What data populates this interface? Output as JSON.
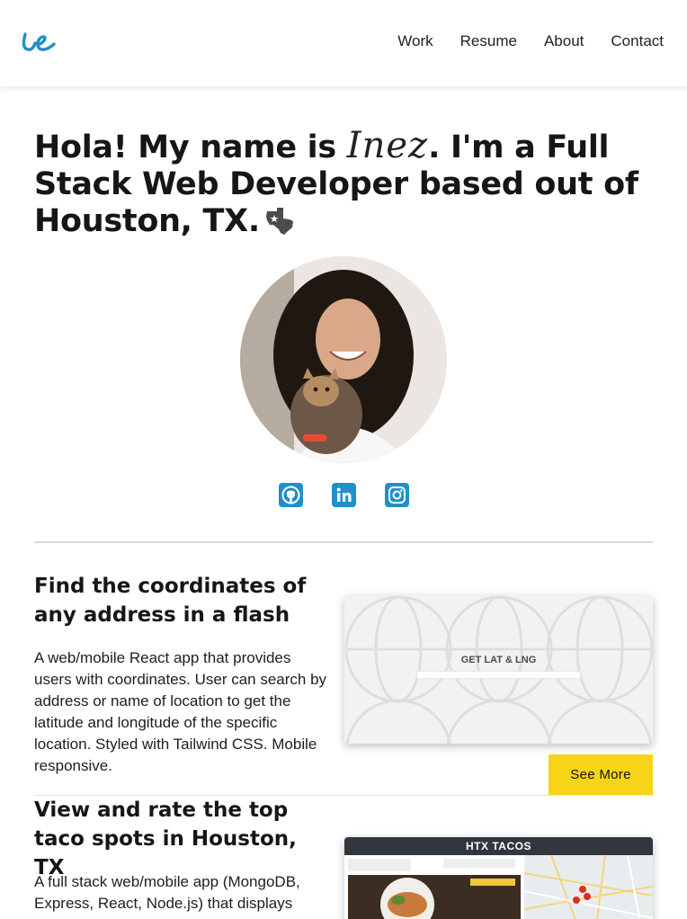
{
  "header": {
    "logo_icon": "ie-script-logo",
    "nav": [
      "Work",
      "Resume",
      "About",
      "Contact"
    ]
  },
  "hero": {
    "line_start": "Hola! My name is ",
    "name": "Inez",
    "line_end": ". I'm a Full Stack Web Developer based out of Houston, TX.",
    "icon": "texas-flag-icon"
  },
  "profile": {
    "avatar_icon": "profile-photo"
  },
  "socials": [
    {
      "name": "github-icon"
    },
    {
      "name": "linkedin-icon"
    },
    {
      "name": "instagram-icon"
    }
  ],
  "projects": [
    {
      "title": "Find the coordinates of any address in a flash",
      "description": "A web/mobile React app that provides users with coordinates. User can search by address or name of location to get the latitude and longitude of the specific location. Styled with Tailwind CSS. Mobile responsive.",
      "screenshot_title": "GET LAT & LNG",
      "cta": "See More"
    },
    {
      "title": "View and rate the top taco spots in Houston, TX",
      "description": "A full stack web/mobile app (MongoDB, Express, React, Node.js) that displays",
      "screenshot_title": "HTX TACOS"
    }
  ],
  "colors": {
    "accent": "#1f90c8",
    "button": "#f7d418"
  }
}
